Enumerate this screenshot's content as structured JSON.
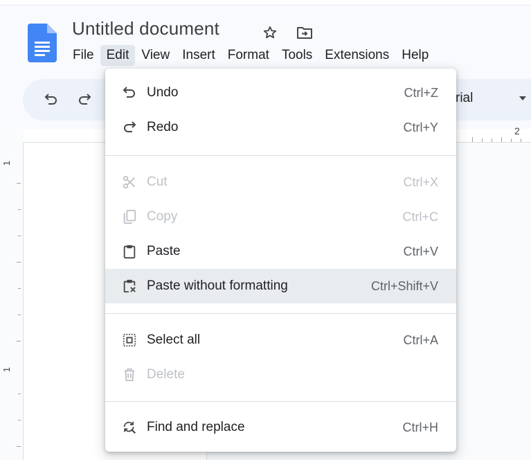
{
  "document": {
    "title": "Untitled document"
  },
  "icons": {
    "logo": "docs-logo-icon",
    "star": "star-icon",
    "move": "move-to-folder-icon"
  },
  "menubar": {
    "items": [
      {
        "label": "File"
      },
      {
        "label": "Edit"
      },
      {
        "label": "View"
      },
      {
        "label": "Insert"
      },
      {
        "label": "Format"
      },
      {
        "label": "Tools"
      },
      {
        "label": "Extensions"
      },
      {
        "label": "Help"
      }
    ],
    "active": "Edit"
  },
  "toolbar": {
    "font_visible_text": "rial"
  },
  "ruler": {
    "top_number": "2",
    "left_number_1": "1",
    "left_number_2": "1"
  },
  "edit_menu": {
    "items": [
      {
        "label": "Undo",
        "shortcut": "Ctrl+Z",
        "icon": "undo-icon",
        "enabled": true
      },
      {
        "label": "Redo",
        "shortcut": "Ctrl+Y",
        "icon": "redo-icon",
        "enabled": true
      },
      {
        "label": "Cut",
        "shortcut": "Ctrl+X",
        "icon": "cut-icon",
        "enabled": false
      },
      {
        "label": "Copy",
        "shortcut": "Ctrl+C",
        "icon": "copy-icon",
        "enabled": false
      },
      {
        "label": "Paste",
        "shortcut": "Ctrl+V",
        "icon": "paste-icon",
        "enabled": true
      },
      {
        "label": "Paste without formatting",
        "shortcut": "Ctrl+Shift+V",
        "icon": "paste-without-formatting-icon",
        "enabled": true,
        "highlighted": true
      },
      {
        "label": "Select all",
        "shortcut": "Ctrl+A",
        "icon": "select-all-icon",
        "enabled": true
      },
      {
        "label": "Delete",
        "shortcut": "",
        "icon": "delete-icon",
        "enabled": false
      },
      {
        "label": "Find and replace",
        "shortcut": "Ctrl+H",
        "icon": "find-replace-icon",
        "enabled": true
      }
    ]
  },
  "colors": {
    "docs_blue": "#4285f4",
    "menu_highlight": "#e9ecef",
    "toolbar_bg": "#edf2fa",
    "disabled_text": "#bdc1c6"
  }
}
